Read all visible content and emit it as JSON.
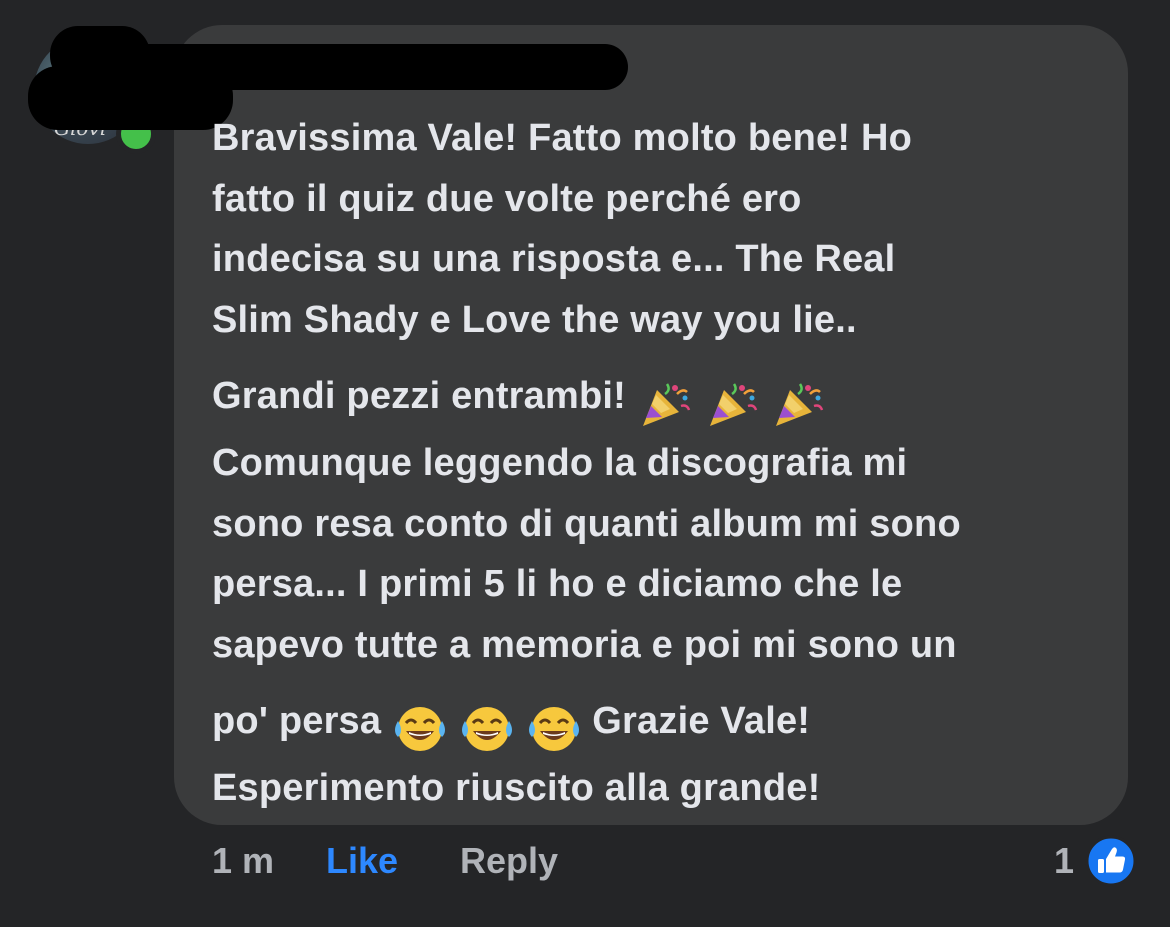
{
  "comment": {
    "paragraph_1_lines": [
      "Bravissima Vale! Fatto molto bene! Ho",
      "fatto il quiz due volte perché ero",
      "indecisa su una risposta e... The Real",
      "Slim Shady e Love the way you lie.."
    ],
    "paragraph_2_line_1": "Grandi pezzi entrambi!",
    "paragraph_2_lines": [
      "Comunque leggendo la discografia mi",
      "sono resa conto di quanti album mi sono",
      "persa... I primi 5 li ho e diciamo che le",
      "sapevo tutte a memoria e poi mi sono un"
    ],
    "paragraph_3_line_1_before": "po' persa",
    "paragraph_3_line_1_after": "Grazie Vale!",
    "paragraph_3_line_2": "Esperimento riuscito alla grande!",
    "emoji_party": "party-popper-icon",
    "emoji_laugh": "tears-of-joy-icon"
  },
  "avatar": {
    "script_text": "Giovi",
    "status": "online"
  },
  "actions": {
    "time": "1 m",
    "like_label": "Like",
    "reply_label": "Reply"
  },
  "reactions": {
    "count": "1",
    "icon": "thumbs-up-icon"
  },
  "colors": {
    "background": "#242527",
    "bubble": "#3a3b3c",
    "text": "#e4e6eb",
    "secondary_text": "#b0b3b8",
    "like_blue": "#2d88ff",
    "online_green": "#44c04a"
  }
}
